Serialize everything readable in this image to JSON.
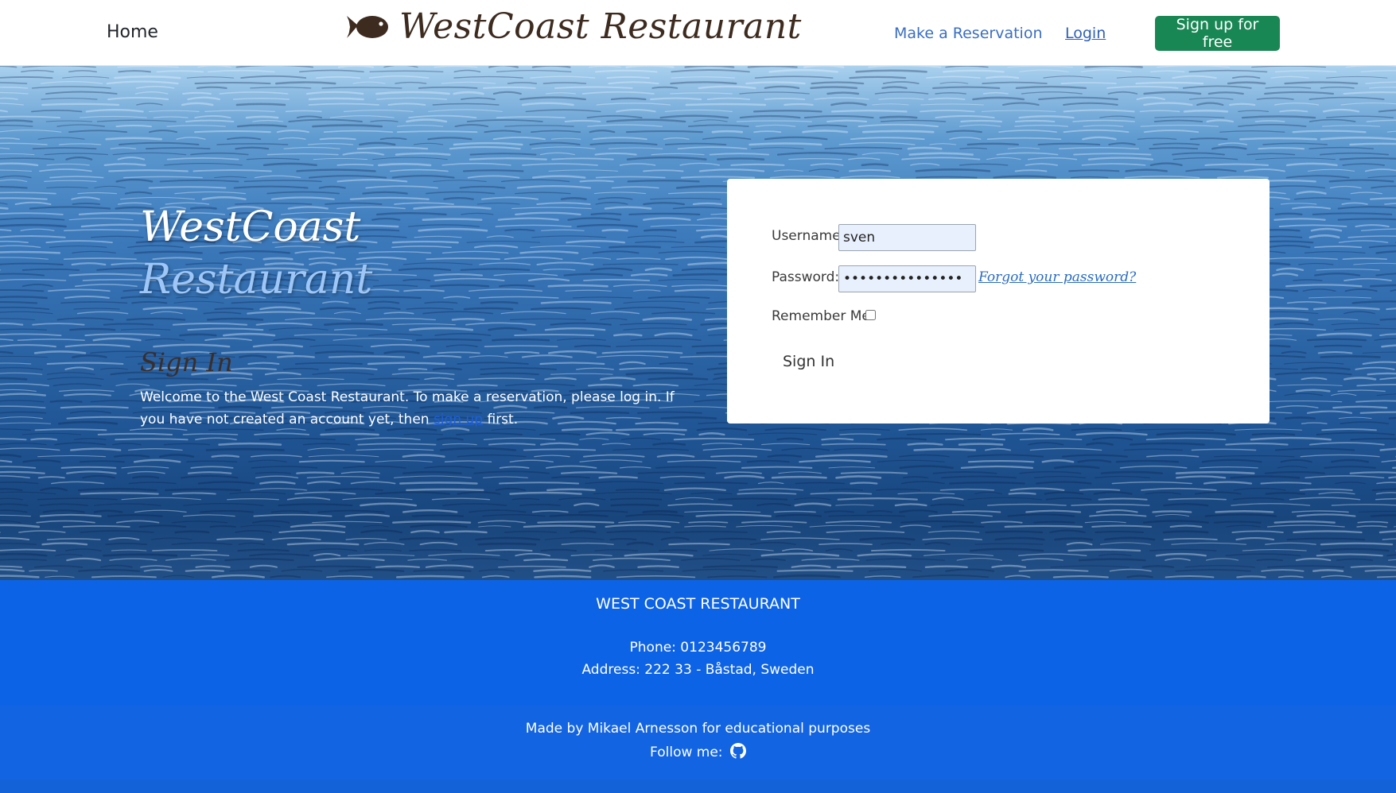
{
  "navbar": {
    "home_label": "Home",
    "brand_text": "WestCoast Restaurant",
    "brand_icon": "fish-icon",
    "reservation_label": "Make a Reservation",
    "login_label": "Login",
    "signup_label": "Sign up for free"
  },
  "hero": {
    "title_line1": "WestCoast",
    "title_line2": "Restaurant",
    "signin_heading": "Sign In",
    "welcome_before": "Welcome to the West Coast Restaurant. To make a reservation, please log in. If you have not created an account yet, then ",
    "welcome_link": "sign up",
    "welcome_after": " first."
  },
  "login_form": {
    "username_label": "Username:",
    "username_value": "sven",
    "password_label": "Password:",
    "password_value": "•••••••••••••••",
    "forgot_label": "Forgot your password?",
    "remember_label": "Remember Me:",
    "remember_checked": false,
    "submit_label": "Sign In"
  },
  "footer": {
    "name": "WEST COAST RESTAURANT",
    "phone": "Phone: 0123456789",
    "address": "Address: 222 33 - Båstad, Sweden",
    "made_by": "Made by Mikael Arnesson for educational purposes",
    "follow_label": "Follow me:",
    "follow_icon": "github-icon"
  },
  "colors": {
    "navbar_bg": "#ffffff",
    "nav_link": "#3b6ec2",
    "signup_bg": "#198754",
    "brand_text": "#3d2b1f",
    "footer_top_bg": "#0d63e6",
    "footer_bottom_bg": "#1264e2"
  }
}
